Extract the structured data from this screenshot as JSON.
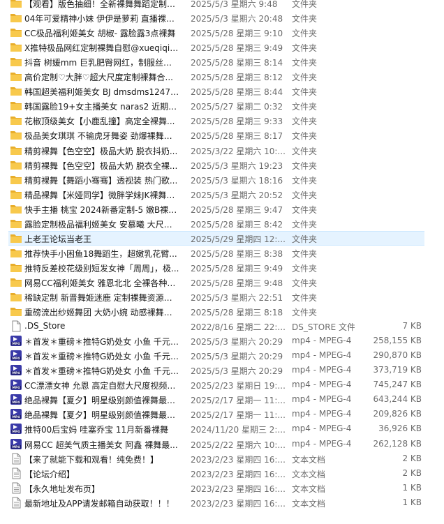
{
  "rows": [
    {
      "name": "【观看】版色抽细！全新裸舞舞蹈定制（...",
      "date": "2025/5/3 星期六 9:48",
      "type": "文件夹",
      "size": "",
      "icon": "folder"
    },
    {
      "name": "04年可爱精神小妹 伊伊是萝莉 直播裸舞...",
      "date": "2025/5/3 星期六 20:48",
      "type": "文件夹",
      "size": "",
      "icon": "folder"
    },
    {
      "name": "CC极品福利姬美女 胡椒- 露脸露3点裸舞",
      "date": "2025/5/28 星期三 9:10",
      "type": "文件夹",
      "size": "",
      "icon": "folder"
    },
    {
      "name": "X推特极品网红定制裸舞自慰@xueqiqiji...",
      "date": "2025/5/28 星期三 9:49",
      "type": "文件夹",
      "size": "",
      "icon": "folder"
    },
    {
      "name": "抖音 树媛mm 巨乳肥臀网红，制服丝袜...",
      "date": "2025/5/28 星期三 8:14",
      "type": "文件夹",
      "size": "",
      "icon": "folder"
    },
    {
      "name": "高价定制♡大胖♡超大尺度定制裸舞合...",
      "date": "2025/5/28 星期三 8:12",
      "type": "文件夹",
      "size": "",
      "icon": "folder"
    },
    {
      "name": "韩国超美福利姬美女 BJ dmsdms1247 ...",
      "date": "2025/5/28 星期三 8:44",
      "type": "文件夹",
      "size": "",
      "icon": "folder"
    },
    {
      "name": "韩国露脸19+女主播美女 naras2 近期裸...",
      "date": "2025/5/27 星期二 0:32",
      "type": "文件夹",
      "size": "",
      "icon": "folder"
    },
    {
      "name": "花椒顶级美女【小鹿乱撞】高定全裸舞...",
      "date": "2025/5/28 星期三 9:33",
      "type": "文件夹",
      "size": "",
      "icon": "folder"
    },
    {
      "name": "极品美女琪琪 不输虎牙舞姿 劲爆裸舞精...",
      "date": "2025/5/28 星期三 8:17",
      "type": "文件夹",
      "size": "",
      "icon": "folder"
    },
    {
      "name": "精剪裸舞【色空空】极品大奶 脱衣抖奶...",
      "date": "2025/3/22 星期六 10:...",
      "type": "文件夹",
      "size": "",
      "icon": "folder"
    },
    {
      "name": "精剪裸舞【色空空】极品大奶 脱衣全裸...",
      "date": "2025/5/3 星期六 19:23",
      "type": "文件夹",
      "size": "",
      "icon": "folder"
    },
    {
      "name": "精剪裸舞【舞蹈小骞骞】透视装 热门歌...",
      "date": "2025/5/3 星期六 18:16",
      "type": "文件夹",
      "size": "",
      "icon": "folder"
    },
    {
      "name": "精品裸舞【米娅同学】微胖学妹JK裸舞大...",
      "date": "2025/5/3 星期六 20:52",
      "type": "文件夹",
      "size": "",
      "icon": "folder"
    },
    {
      "name": "快手主播 桃宝 2024新番定制-5 嫩B裸舞...",
      "date": "2025/5/28 星期三 9:47",
      "type": "文件夹",
      "size": "",
      "icon": "folder"
    },
    {
      "name": "露脸定制极品福利姬美女 安慕曦 大尺度...",
      "date": "2025/5/28 星期三 8:42",
      "type": "文件夹",
      "size": "",
      "icon": "folder"
    },
    {
      "name": "上老王论坛当老王",
      "date": "2025/5/29 星期四 12:...",
      "type": "文件夹",
      "size": "",
      "icon": "folder",
      "selected": true
    },
    {
      "name": "推荐快手小困鱼18舞蹈生，超嫩乳花臂...",
      "date": "2025/5/28 星期三 8:38",
      "type": "文件夹",
      "size": "",
      "icon": "folder"
    },
    {
      "name": "推特反差校花级别短发女神「周周」，极...",
      "date": "2025/5/28 星期三 9:49",
      "type": "文件夹",
      "size": "",
      "icon": "folder"
    },
    {
      "name": "网易CC福利姬美女 雅恩北北 全裸各种情...",
      "date": "2025/5/28 星期三 9:48",
      "type": "文件夹",
      "size": "",
      "icon": "folder"
    },
    {
      "name": "稀缺定制 新晋舞姬迷鹿 定制裸舞资源视...",
      "date": "2025/5/3 星期六 22:51",
      "type": "文件夹",
      "size": "",
      "icon": "folder"
    },
    {
      "name": "重磅流出纱姬舞团 大奶小婉 动感裸舞摇...",
      "date": "2025/5/28 星期三 8:18",
      "type": "文件夹",
      "size": "",
      "icon": "folder"
    },
    {
      "name": ".DS_Store",
      "date": "2022/8/16 星期二 22:...",
      "type": "DS_STORE 文件",
      "size": "7 KB",
      "icon": "file"
    },
    {
      "name": "＊首发＊重磅＊推特G奶处女 小鱼 千元定...",
      "date": "2025/5/3 星期六 20:29",
      "type": "mp4 - MPEG-4 ...",
      "size": "258,155 KB",
      "icon": "mp4"
    },
    {
      "name": "＊首发＊重磅＊推特G奶处女 小鱼 千元定...",
      "date": "2025/5/3 星期六 20:29",
      "type": "mp4 - MPEG-4 ...",
      "size": "290,870 KB",
      "icon": "mp4"
    },
    {
      "name": "＊首发＊重磅＊推特G奶处女 小鱼 千元定...",
      "date": "2025/5/3 星期六 20:29",
      "type": "mp4 - MPEG-4 ...",
      "size": "373,719 KB",
      "icon": "mp4"
    },
    {
      "name": "CC漂漂女神 允恩 高定自慰大尺度视频福...",
      "date": "2025/2/23 星期日 19:...",
      "type": "mp4 - MPEG-4 ...",
      "size": "745,247 KB",
      "icon": "mp4"
    },
    {
      "name": "绝品裸舞【夏夕】明星级别颜值裸舞最主...",
      "date": "2025/2/17 星期一 11:...",
      "type": "mp4 - MPEG-4 ...",
      "size": "643,244 KB",
      "icon": "mp4"
    },
    {
      "name": "绝品裸舞【夏夕】明星级别颜值裸舞最主...",
      "date": "2025/2/17 星期一 11:...",
      "type": "mp4 - MPEG-4 ...",
      "size": "209,826 KB",
      "icon": "mp4"
    },
    {
      "name": "推特00后宝妈 哇塞乔宝 11月新番裸舞",
      "date": "2024/11/20 星期三 2:...",
      "type": "mp4 - MPEG-4 ...",
      "size": "36,926 KB",
      "icon": "mp4"
    },
    {
      "name": "网易CC 超美气质主播美女 阿鑫 裸舞最...",
      "date": "2025/2/22 星期六 10:...",
      "type": "mp4 - MPEG-4 ...",
      "size": "262,128 KB",
      "icon": "mp4"
    },
    {
      "name": "【来了就能下载和观看！纯免费！】",
      "date": "2023/2/23 星期四 16:...",
      "type": "文本文档",
      "size": "2 KB",
      "icon": "text"
    },
    {
      "name": "【论坛介绍】",
      "date": "2023/2/23 星期四 16:...",
      "type": "文本文档",
      "size": "2 KB",
      "icon": "text"
    },
    {
      "name": "【永久地址发布页】",
      "date": "2023/2/23 星期四 16:...",
      "type": "文本文档",
      "size": "1 KB",
      "icon": "text"
    },
    {
      "name": "最新地址及APP请发邮箱自动获取！！！",
      "date": "2023/2/23 星期四 16:...",
      "type": "文本文档",
      "size": "1 KB",
      "icon": "text"
    }
  ],
  "colors": {
    "folder": "#f8c94c",
    "folder_dark": "#e8ad2a",
    "selection": "#e5f3ff",
    "mp4_badge": "#3a3aa8"
  },
  "mp4_badge_text": "MP4"
}
